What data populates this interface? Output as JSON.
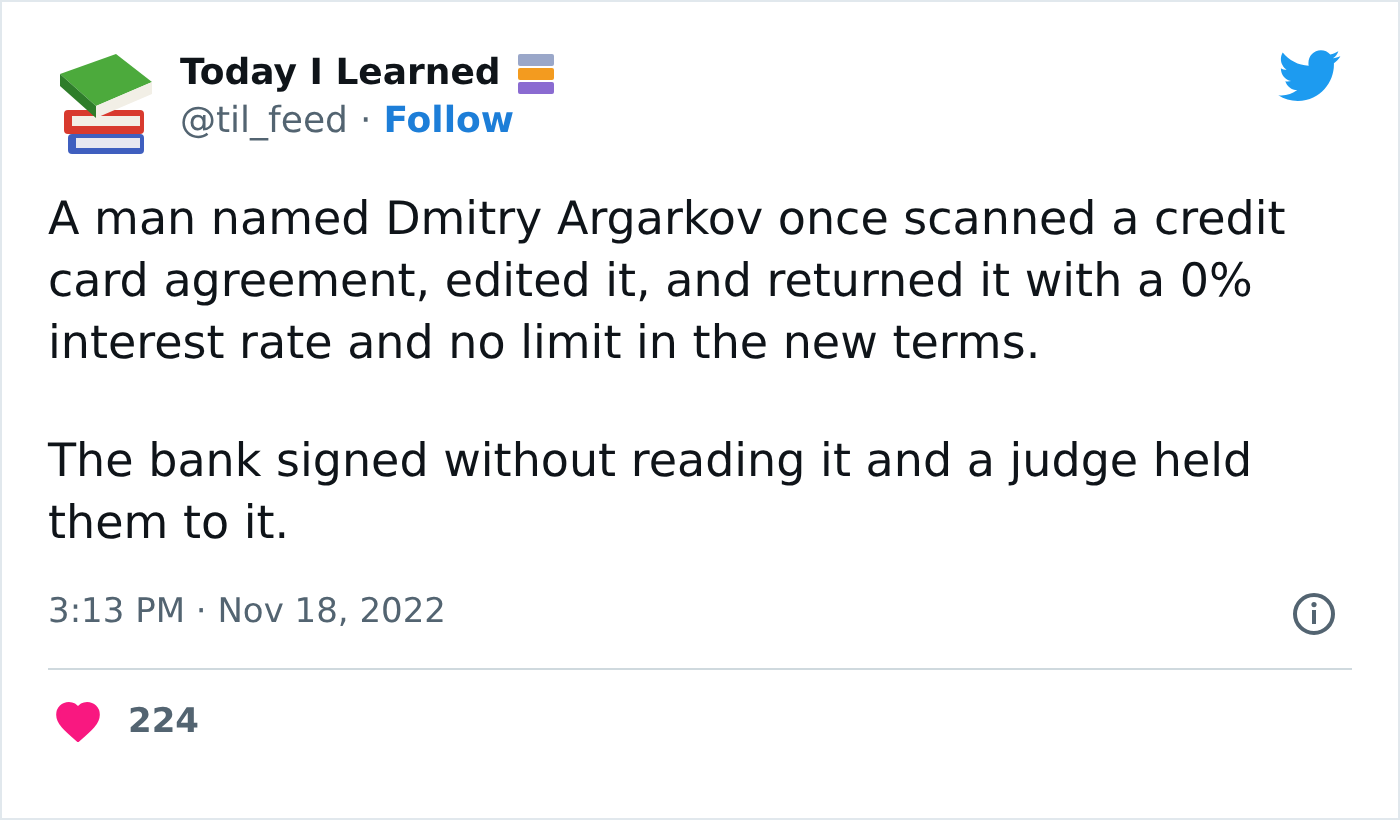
{
  "author": {
    "name": "Today I Learned",
    "handle": "@til_feed",
    "separator": "·",
    "follow": "Follow"
  },
  "paragraphs": [
    "A man named Dmitry Argarkov once scanned a credit card agreement, edited it, and returned it with a 0% interest rate and no limit in the new terms.",
    "The bank signed without reading it and a judge held them to it."
  ],
  "timestamp": "3:13 PM · Nov 18, 2022",
  "likes": {
    "count": "224",
    "liked": true
  }
}
